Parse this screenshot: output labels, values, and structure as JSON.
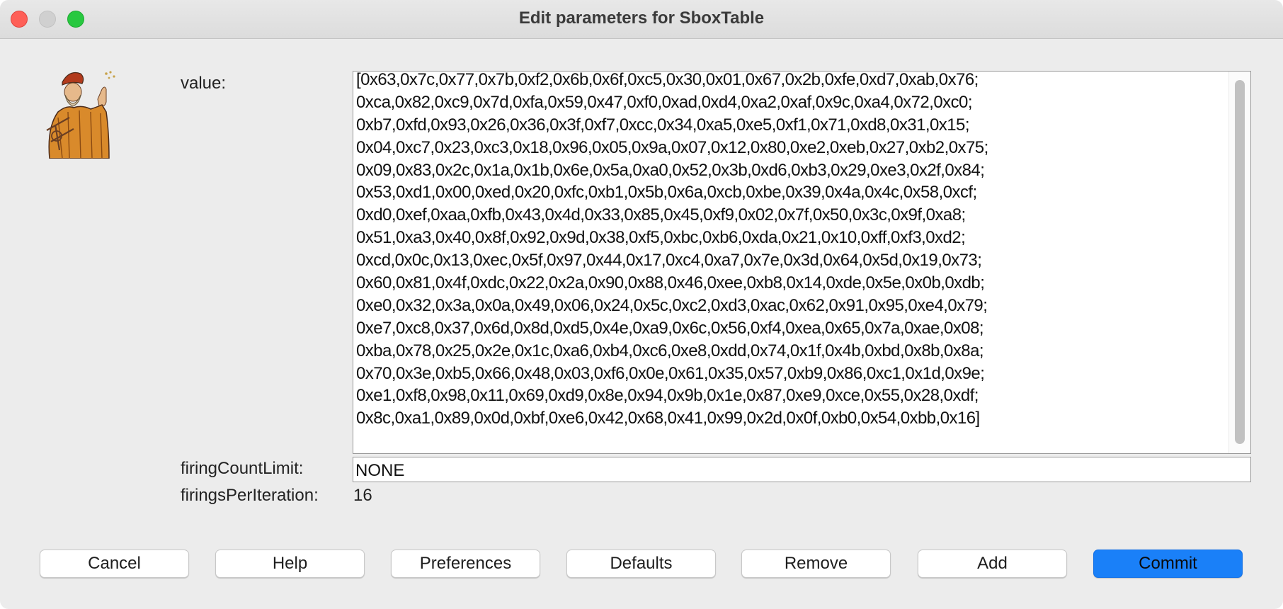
{
  "window": {
    "title": "Edit parameters for SboxTable"
  },
  "params": {
    "value_label": "value:",
    "value_lines": [
      "[0x63,0x7c,0x77,0x7b,0xf2,0x6b,0x6f,0xc5,0x30,0x01,0x67,0x2b,0xfe,0xd7,0xab,0x76;",
      "0xca,0x82,0xc9,0x7d,0xfa,0x59,0x47,0xf0,0xad,0xd4,0xa2,0xaf,0x9c,0xa4,0x72,0xc0;",
      "0xb7,0xfd,0x93,0x26,0x36,0x3f,0xf7,0xcc,0x34,0xa5,0xe5,0xf1,0x71,0xd8,0x31,0x15;",
      "0x04,0xc7,0x23,0xc3,0x18,0x96,0x05,0x9a,0x07,0x12,0x80,0xe2,0xeb,0x27,0xb2,0x75;",
      "0x09,0x83,0x2c,0x1a,0x1b,0x6e,0x5a,0xa0,0x52,0x3b,0xd6,0xb3,0x29,0xe3,0x2f,0x84;",
      "0x53,0xd1,0x00,0xed,0x20,0xfc,0xb1,0x5b,0x6a,0xcb,0xbe,0x39,0x4a,0x4c,0x58,0xcf;",
      "0xd0,0xef,0xaa,0xfb,0x43,0x4d,0x33,0x85,0x45,0xf9,0x02,0x7f,0x50,0x3c,0x9f,0xa8;",
      "0x51,0xa3,0x40,0x8f,0x92,0x9d,0x38,0xf5,0xbc,0xb6,0xda,0x21,0x10,0xff,0xf3,0xd2;",
      "0xcd,0x0c,0x13,0xec,0x5f,0x97,0x44,0x17,0xc4,0xa7,0x7e,0x3d,0x64,0x5d,0x19,0x73;",
      "0x60,0x81,0x4f,0xdc,0x22,0x2a,0x90,0x88,0x46,0xee,0xb8,0x14,0xde,0x5e,0x0b,0xdb;",
      "0xe0,0x32,0x3a,0x0a,0x49,0x06,0x24,0x5c,0xc2,0xd3,0xac,0x62,0x91,0x95,0xe4,0x79;",
      "0xe7,0xc8,0x37,0x6d,0x8d,0xd5,0x4e,0xa9,0x6c,0x56,0xf4,0xea,0x65,0x7a,0xae,0x08;",
      "0xba,0x78,0x25,0x2e,0x1c,0xa6,0xb4,0xc6,0xe8,0xdd,0x74,0x1f,0x4b,0xbd,0x8b,0x8a;",
      "0x70,0x3e,0xb5,0x66,0x48,0x03,0xf6,0x0e,0x61,0x35,0x57,0xb9,0x86,0xc1,0x1d,0x9e;",
      "0xe1,0xf8,0x98,0x11,0x69,0xd9,0x8e,0x94,0x9b,0x1e,0x87,0xe9,0xce,0x55,0x28,0xdf;",
      "0x8c,0xa1,0x89,0x0d,0xbf,0xe6,0x42,0x68,0x41,0x99,0x2d,0x0f,0xb0,0x54,0xbb,0x16]"
    ],
    "firing_count_limit_label": "firingCountLimit:",
    "firing_count_limit_value": "NONE",
    "firings_per_iteration_label": "firingsPerIteration:",
    "firings_per_iteration_value": "16"
  },
  "buttons": {
    "cancel": "Cancel",
    "help": "Help",
    "preferences": "Preferences",
    "defaults": "Defaults",
    "remove": "Remove",
    "add": "Add",
    "commit": "Commit"
  },
  "colors": {
    "primary_button": "#1a80f8",
    "close_button": "#fe5f57",
    "zoom_button": "#28c840",
    "window_background": "#ececec"
  },
  "icons": {
    "traffic_close": "close-window-icon",
    "traffic_minimize": "minimize-window-icon",
    "traffic_zoom": "zoom-window-icon",
    "portrait": "astronomer-portrait-icon"
  }
}
